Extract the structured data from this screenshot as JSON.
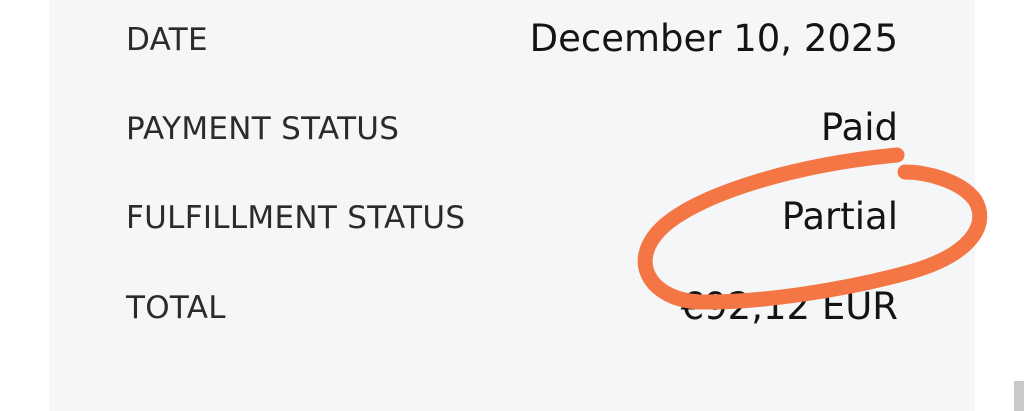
{
  "order_details": {
    "rows": [
      {
        "label": "DATE",
        "value": "December 10, 2025"
      },
      {
        "label": "PAYMENT STATUS",
        "value": "Paid"
      },
      {
        "label": "FULFILLMENT STATUS",
        "value": "Partial"
      },
      {
        "label": "TOTAL",
        "value": "€92,12 EUR"
      }
    ]
  },
  "colors": {
    "panel_background": "#f5f6f8",
    "annotation_stroke": "#f47645"
  }
}
